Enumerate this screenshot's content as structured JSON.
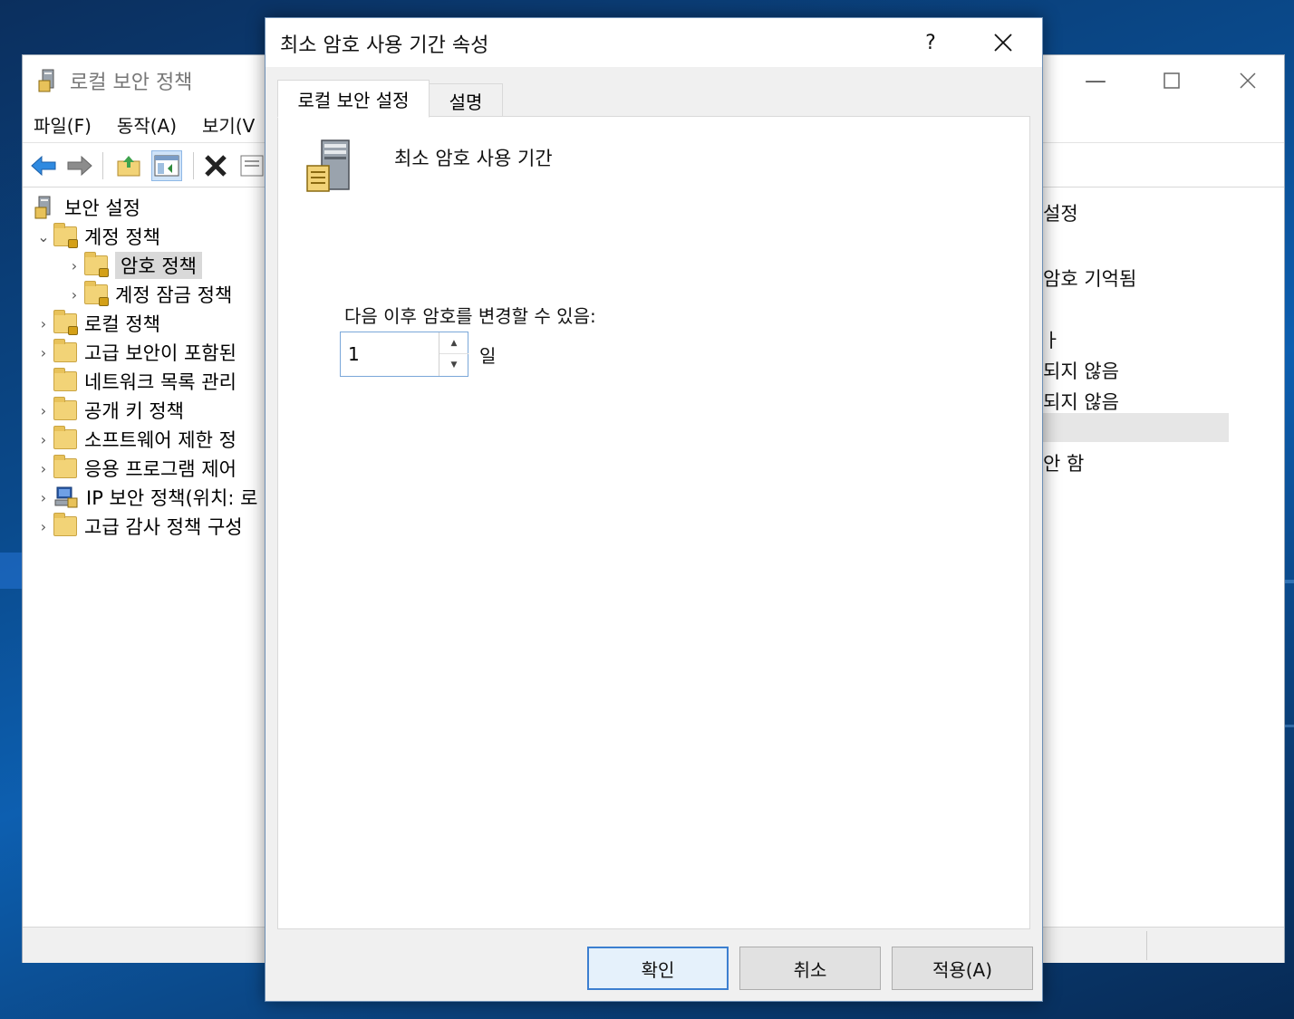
{
  "background_window": {
    "title": "로컬 보안 정책",
    "menu": [
      "파일(F)",
      "동작(A)",
      "보기(V"
    ],
    "toolbar_icons": [
      "back-arrow-icon",
      "forward-arrow-icon",
      "up-folder-icon",
      "show-hide-tree-icon",
      "delete-icon",
      "properties-icon"
    ],
    "tree": [
      {
        "label": "보안 설정",
        "expander": "",
        "level": 0,
        "icon": "security-settings-icon"
      },
      {
        "label": "계정 정책",
        "expander": "⌄",
        "level": 1,
        "icon": "folder-lock-icon"
      },
      {
        "label": "암호 정책",
        "expander": "›",
        "level": 2,
        "icon": "folder-lock-icon",
        "selected": true
      },
      {
        "label": "계정 잠금 정책",
        "expander": "›",
        "level": 2,
        "icon": "folder-lock-icon"
      },
      {
        "label": "로컬 정책",
        "expander": "›",
        "level": 1,
        "icon": "folder-lock-icon"
      },
      {
        "label": "고급 보안이 포함된",
        "expander": "›",
        "level": 1,
        "icon": "folder-icon"
      },
      {
        "label": "네트워크 목록 관리",
        "expander": "",
        "level": 1,
        "icon": "folder-icon"
      },
      {
        "label": "공개 키 정책",
        "expander": "›",
        "level": 1,
        "icon": "folder-icon"
      },
      {
        "label": "소프트웨어 제한 정",
        "expander": "›",
        "level": 1,
        "icon": "folder-icon"
      },
      {
        "label": "응용 프로그램 제어",
        "expander": "›",
        "level": 1,
        "icon": "folder-icon"
      },
      {
        "label": "IP 보안 정책(위치: 로",
        "expander": "›",
        "level": 1,
        "icon": "ip-security-icon"
      },
      {
        "label": "고급 감사 정책 구성",
        "expander": "›",
        "level": 1,
        "icon": "folder-icon"
      }
    ],
    "right_pane": [
      "설정",
      "암호 기억됨",
      "ㅏ",
      "되지 않음",
      "되지 않음",
      "안 함"
    ]
  },
  "dialog": {
    "title": "최소 암호 사용 기간 속성",
    "help_label": "?",
    "tabs": [
      {
        "label": "로컬 보안 설정",
        "active": true
      },
      {
        "label": "설명",
        "active": false
      }
    ],
    "policy_name": "최소 암호 사용 기간",
    "field_label": "다음 이후 암호를 변경할 수 있음:",
    "field_value": "1",
    "unit": "일",
    "buttons": {
      "ok": "확인",
      "cancel": "취소",
      "apply": "적용(A)"
    }
  }
}
